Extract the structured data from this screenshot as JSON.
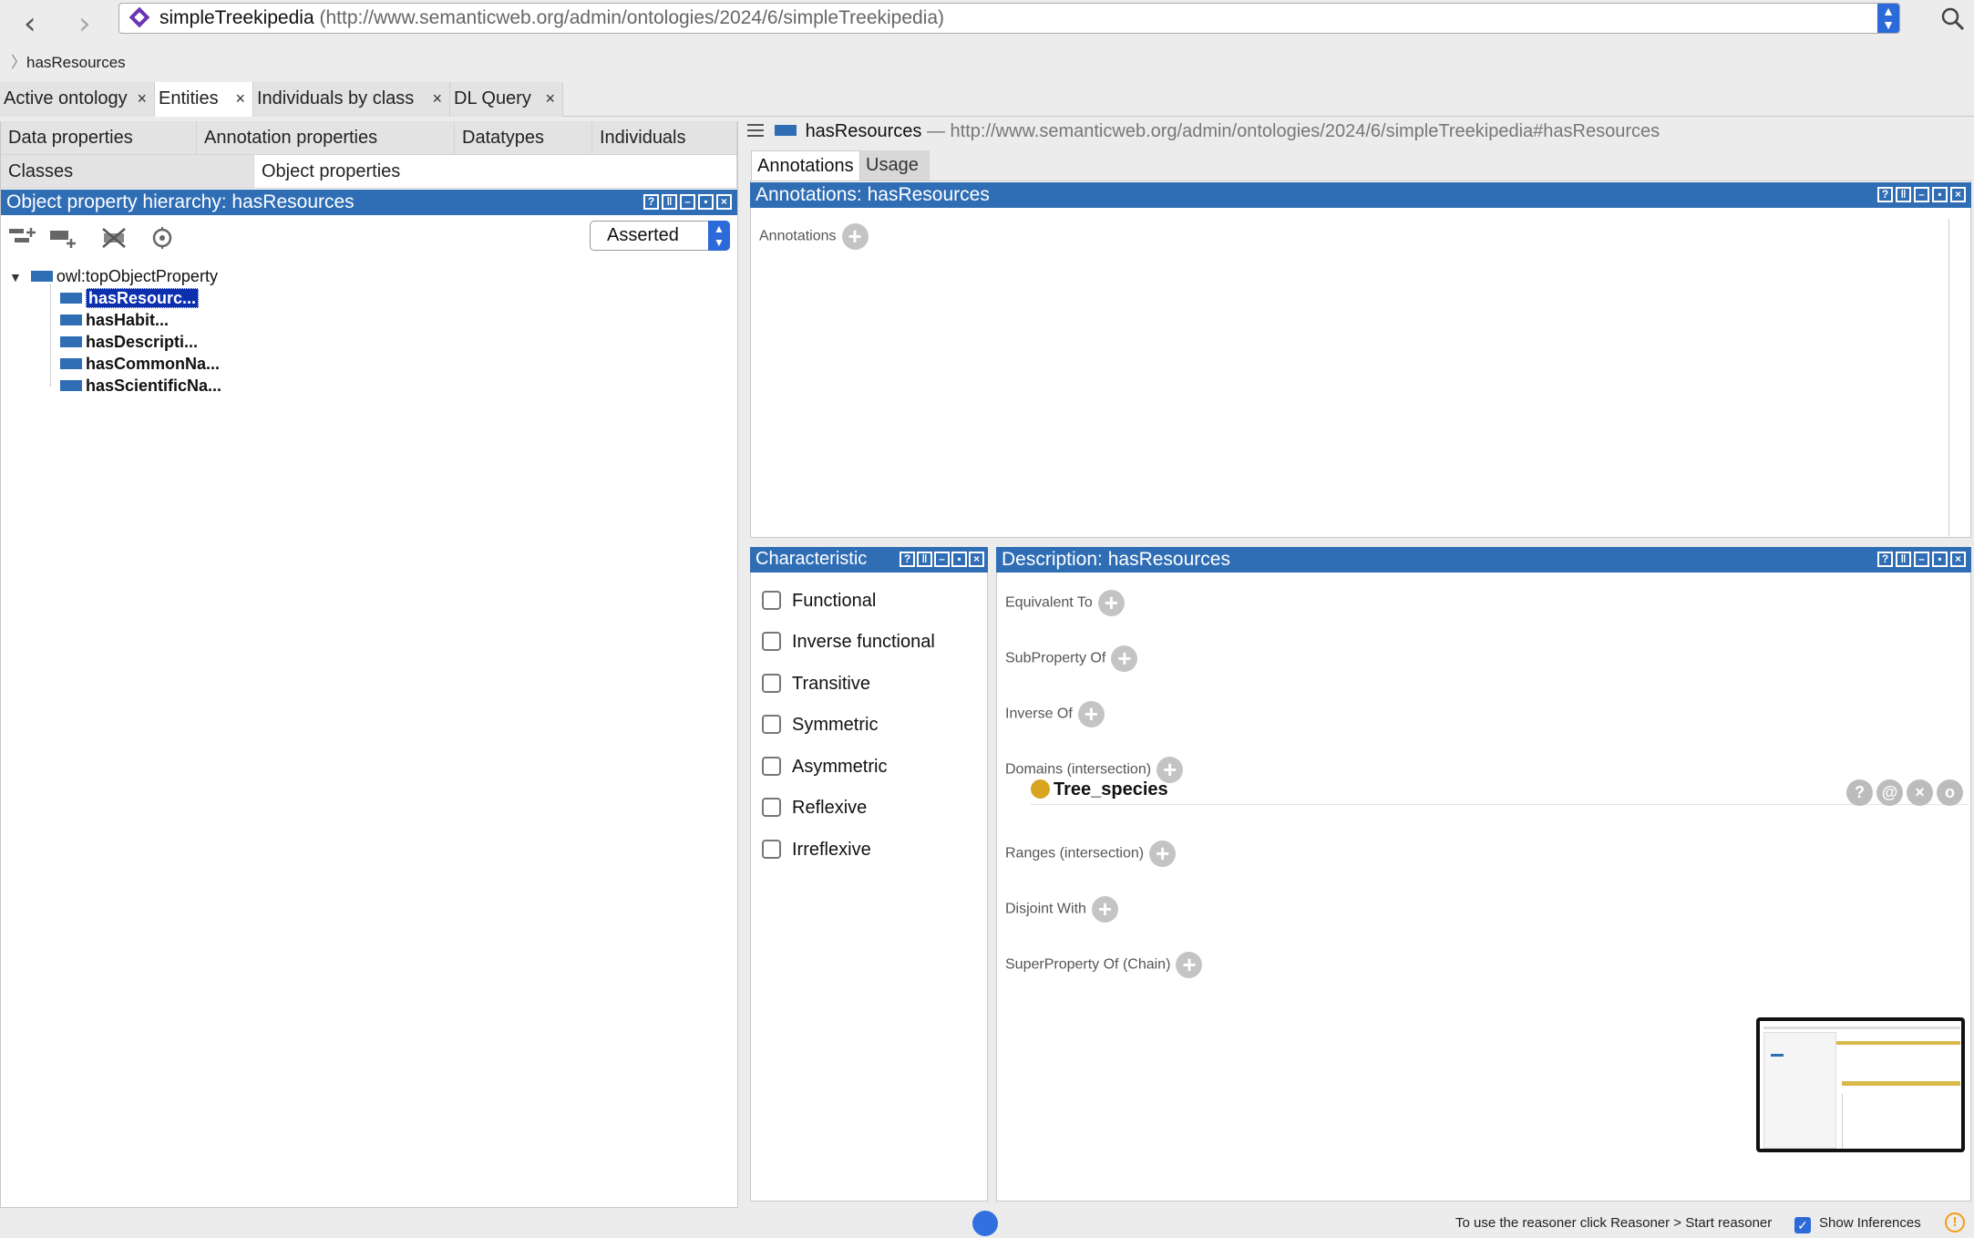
{
  "nav": {
    "back": "‹",
    "forward": "›"
  },
  "url": {
    "ontology_name": "simpleTreekipedia",
    "ontology_iri": "(http://www.semanticweb.org/admin/ontologies/2024/6/simpleTreekipedia)"
  },
  "breadcrumb": {
    "current": "hasResources"
  },
  "main_tabs": [
    {
      "label": "Active ontology",
      "close": "×"
    },
    {
      "label": "Entities",
      "close": "×"
    },
    {
      "label": "Individuals by class",
      "close": "×"
    },
    {
      "label": "DL Query",
      "close": "×"
    }
  ],
  "entity_subtabs": {
    "data_properties": "Data properties",
    "annotation_properties": "Annotation properties",
    "datatypes": "Datatypes",
    "individuals": "Individuals",
    "classes": "Classes",
    "object_properties": "Object properties"
  },
  "hierarchy": {
    "title": "Object property hierarchy: hasResources",
    "mode": "Asserted",
    "root": "owl:topObjectProperty",
    "children": [
      "hasResourc...",
      "hasHabit...",
      "hasDescripti...",
      "hasCommonNa...",
      "hasScientificNa..."
    ]
  },
  "entity": {
    "name": "hasResources",
    "separator": "—",
    "iri": "http://www.semanticweb.org/admin/ontologies/2024/6/simpleTreekipedia#hasResources"
  },
  "right_tabs": {
    "annotations": "Annotations",
    "usage": "Usage"
  },
  "annotations_view": {
    "title": "Annotations: hasResources",
    "label": "Annotations"
  },
  "characteristics": {
    "title": "Characteristic",
    "items": [
      "Functional",
      "Inverse functional",
      "Transitive",
      "Symmetric",
      "Asymmetric",
      "Reflexive",
      "Irreflexive"
    ]
  },
  "description": {
    "title": "Description: hasResources",
    "sections": [
      "Equivalent To",
      "SubProperty Of",
      "Inverse Of",
      "Domains (intersection)",
      "Ranges (intersection)",
      "Disjoint With",
      "SuperProperty Of (Chain)"
    ],
    "domain_value": "Tree_species",
    "row_buttons": [
      "?",
      "@",
      "×",
      "o"
    ]
  },
  "status": {
    "reasoner_hint": "To use the reasoner click Reasoner > Start reasoner",
    "show_inferences": "Show Inferences",
    "show_inferences_checked": true,
    "warning": "!"
  },
  "colors": {
    "header_blue": "#2f6db5",
    "selection_blue": "#0c2fae",
    "class_gold": "#d9a520",
    "accent_blue": "#2d6ad9"
  }
}
